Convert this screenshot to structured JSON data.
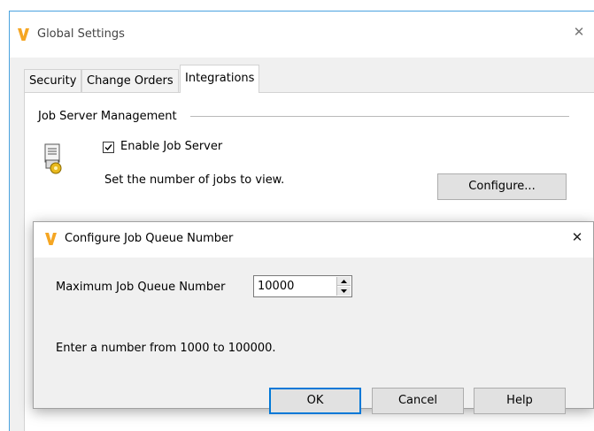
{
  "main_window": {
    "title": "Global Settings",
    "close_glyph": "✕",
    "tabs": [
      {
        "label": "Security"
      },
      {
        "label": "Change Orders"
      },
      {
        "label": "Integrations"
      }
    ],
    "active_tab": "Integrations",
    "group_title": "Job Server Management",
    "enable_job_server_label": "Enable Job Server",
    "enable_job_server_checked": true,
    "jobs_text": "Set the number of jobs to view.",
    "configure_button": "Configure..."
  },
  "dialog": {
    "title": "Configure Job Queue Number",
    "close_glyph": "✕",
    "field_label": "Maximum Job Queue Number",
    "field_value": "10000",
    "hint": "Enter a number from 1000 to 100000.",
    "ok_button": "OK",
    "cancel_button": "Cancel",
    "help_button": "Help"
  },
  "colors": {
    "window_border": "#4aa3df",
    "logo": "#f5a623",
    "button_face": "#e1e1e1",
    "focus_border": "#0078d7"
  }
}
